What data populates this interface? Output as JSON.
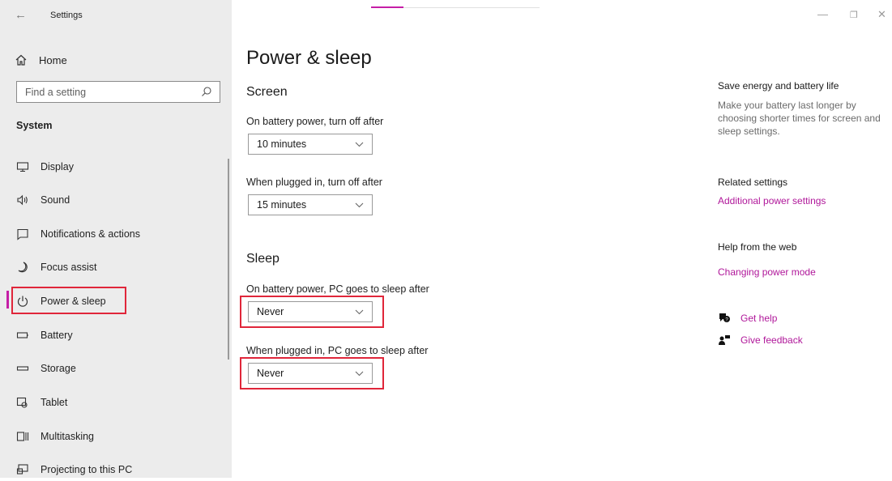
{
  "window": {
    "title": "Settings",
    "back_glyph": "←",
    "controls": {
      "minimize": "—",
      "restore": "❐",
      "close": "✕"
    }
  },
  "sidebar": {
    "home_label": "Home",
    "search_placeholder": "Find a setting",
    "section_label": "System",
    "items": [
      {
        "label": "Display",
        "icon": "display-icon"
      },
      {
        "label": "Sound",
        "icon": "sound-icon"
      },
      {
        "label": "Notifications & actions",
        "icon": "notifications-icon"
      },
      {
        "label": "Focus assist",
        "icon": "focus-assist-icon"
      },
      {
        "label": "Power & sleep",
        "icon": "power-icon",
        "active": true
      },
      {
        "label": "Battery",
        "icon": "battery-icon"
      },
      {
        "label": "Storage",
        "icon": "storage-icon"
      },
      {
        "label": "Tablet",
        "icon": "tablet-icon"
      },
      {
        "label": "Multitasking",
        "icon": "multitasking-icon"
      },
      {
        "label": "Projecting to this PC",
        "icon": "projecting-icon"
      }
    ]
  },
  "main": {
    "title": "Power & sleep",
    "screen": {
      "heading": "Screen",
      "battery_label": "On battery power, turn off after",
      "battery_value": "10 minutes",
      "plugged_label": "When plugged in, turn off after",
      "plugged_value": "15 minutes"
    },
    "sleep": {
      "heading": "Sleep",
      "battery_label": "On battery power, PC goes to sleep after",
      "battery_value": "Never",
      "plugged_label": "When plugged in, PC goes to sleep after",
      "plugged_value": "Never"
    }
  },
  "right_panel": {
    "save_energy_title": "Save energy and battery life",
    "save_energy_text": "Make your battery last longer by choosing shorter times for screen and sleep settings.",
    "related_title": "Related settings",
    "related_link": "Additional power settings",
    "help_web_title": "Help from the web",
    "help_web_link": "Changing power mode",
    "get_help": "Get help",
    "give_feedback": "Give feedback"
  },
  "colors": {
    "accent": "#c51ea6",
    "highlight_box": "#e0263a",
    "sidebar_bg": "#ececec"
  }
}
